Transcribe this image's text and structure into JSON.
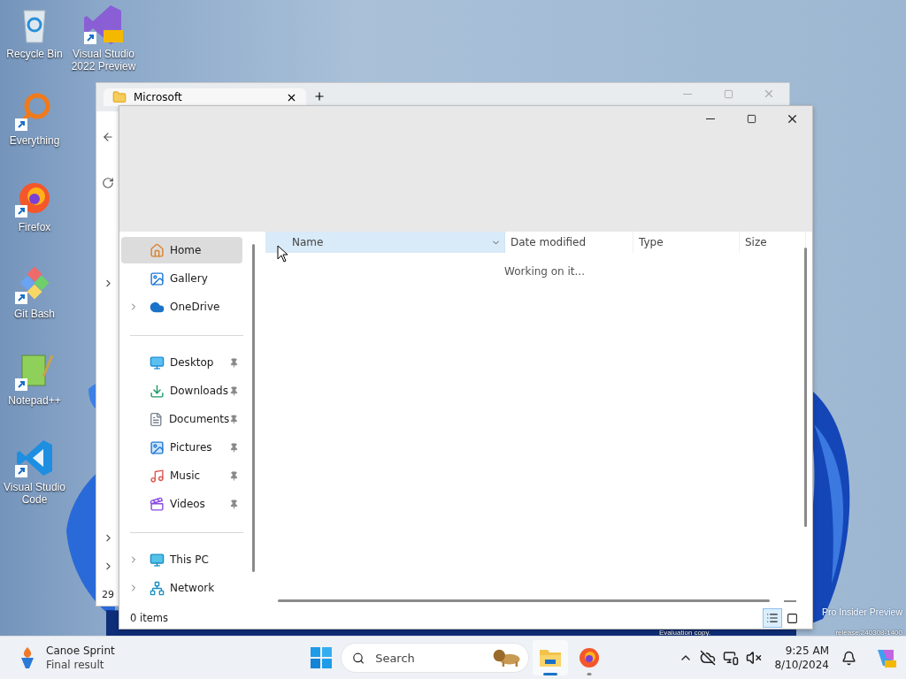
{
  "desktop_icons": [
    {
      "label": "Recycle Bin",
      "kind": "recycle",
      "shortcut": false
    },
    {
      "label": "Everything",
      "kind": "everything",
      "shortcut": true
    },
    {
      "label": "Firefox",
      "kind": "firefox",
      "shortcut": true
    },
    {
      "label": "Git Bash",
      "kind": "git",
      "shortcut": true
    },
    {
      "label": "Notepad++",
      "kind": "notepad",
      "shortcut": true
    },
    {
      "label": "Visual Studio Code",
      "kind": "vscode",
      "shortcut": true
    },
    {
      "label": "Visual Studio 2022 Preview",
      "kind": "vs",
      "shortcut": true
    }
  ],
  "build_text": {
    "line_1": "Pro Insider Preview",
    "line_2a": "Evaluation copy.",
    "line_2b": "release.240308-1400"
  },
  "back_window": {
    "tab_title": "Microsoft",
    "status": "29"
  },
  "explorer": {
    "nav": [
      {
        "items": [
          {
            "label": "Home",
            "kind": "home",
            "selected": true,
            "expandable": false,
            "pinned": false
          },
          {
            "label": "Gallery",
            "kind": "gallery",
            "selected": false,
            "expandable": false,
            "pinned": false
          },
          {
            "label": "OneDrive",
            "kind": "cloud",
            "selected": false,
            "expandable": true,
            "pinned": false
          }
        ]
      },
      {
        "items": [
          {
            "label": "Desktop",
            "kind": "desktop",
            "selected": false,
            "expandable": false,
            "pinned": true
          },
          {
            "label": "Downloads",
            "kind": "downloads",
            "selected": false,
            "expandable": false,
            "pinned": true
          },
          {
            "label": "Documents",
            "kind": "documents",
            "selected": false,
            "expandable": false,
            "pinned": true
          },
          {
            "label": "Pictures",
            "kind": "pictures",
            "selected": false,
            "expandable": false,
            "pinned": true
          },
          {
            "label": "Music",
            "kind": "music",
            "selected": false,
            "expandable": false,
            "pinned": true
          },
          {
            "label": "Videos",
            "kind": "videos",
            "selected": false,
            "expandable": false,
            "pinned": true
          }
        ]
      },
      {
        "items": [
          {
            "label": "This PC",
            "kind": "pc",
            "selected": false,
            "expandable": true,
            "pinned": false
          },
          {
            "label": "Network",
            "kind": "network",
            "selected": false,
            "expandable": true,
            "pinned": false
          }
        ]
      }
    ],
    "columns": [
      {
        "label": "Name",
        "selected": true
      },
      {
        "label": "Date modified",
        "selected": false
      },
      {
        "label": "Type",
        "selected": false
      },
      {
        "label": "Size",
        "selected": false
      }
    ],
    "message": "Working on it...",
    "status": "0 items",
    "views": [
      {
        "kind": "details",
        "selected": true
      },
      {
        "kind": "tiles",
        "selected": false
      }
    ]
  },
  "taskbar": {
    "widget": {
      "title": "Canoe Sprint",
      "subtitle": "Final result"
    },
    "search": {
      "placeholder": "Search"
    },
    "apps": [
      {
        "kind": "explorer",
        "selected": true
      },
      {
        "kind": "firefox",
        "selected": false
      }
    ],
    "clock": {
      "time": "9:25 AM",
      "date": "8/10/2024"
    }
  }
}
